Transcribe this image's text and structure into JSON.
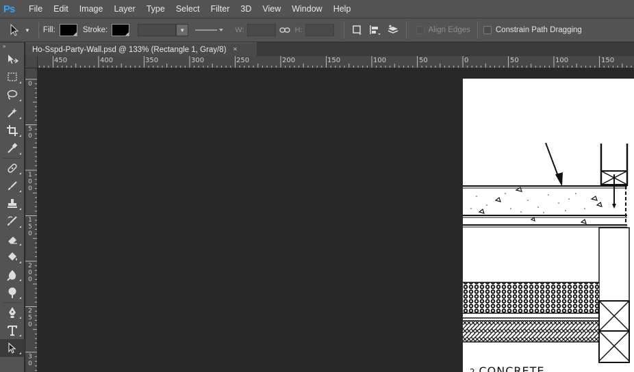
{
  "app": {
    "logo": "Ps"
  },
  "menu": [
    "File",
    "Edit",
    "Image",
    "Layer",
    "Type",
    "Select",
    "Filter",
    "3D",
    "View",
    "Window",
    "Help"
  ],
  "options": {
    "fill_label": "Fill:",
    "stroke_label": "Stroke:",
    "fill_color": "#000000",
    "stroke_color": "#000000",
    "w_label": "W:",
    "h_label": "H:",
    "align_edges": "Align Edges",
    "constrain": "Constrain Path Dragging"
  },
  "document": {
    "tab_title": "Ho-Sspd-Party-Wall.psd @ 133% (Rectangle 1, Gray/8)",
    "close": "×",
    "visible_text": "CONCRETE"
  },
  "ruler_h": [
    "450",
    "400",
    "350",
    "300",
    "250",
    "200",
    "150",
    "100",
    "50",
    "0",
    "50",
    "100",
    "150"
  ],
  "ruler_v": [
    [
      "0"
    ],
    [
      "5",
      "0"
    ],
    [
      "1",
      "0",
      "0"
    ],
    [
      "1",
      "5",
      "0"
    ],
    [
      "2",
      "0",
      "0"
    ],
    [
      "2",
      "5",
      "0"
    ],
    [
      "3",
      "0"
    ]
  ],
  "tools": [
    "move-tool",
    "marquee-tool",
    "lasso-tool",
    "magic-wand-tool",
    "crop-tool",
    "eyedropper-tool",
    "healing-tool",
    "brush-tool",
    "stamp-tool",
    "history-brush-tool",
    "eraser-tool",
    "paint-bucket-tool",
    "blur-tool",
    "dodge-tool",
    "pen-tool",
    "type-tool",
    "path-selection-tool"
  ],
  "active_tool": "path-selection-tool",
  "colors": {
    "menubar": "#535353",
    "canvas_bg": "#282828",
    "accent": "#2fa4ff"
  }
}
